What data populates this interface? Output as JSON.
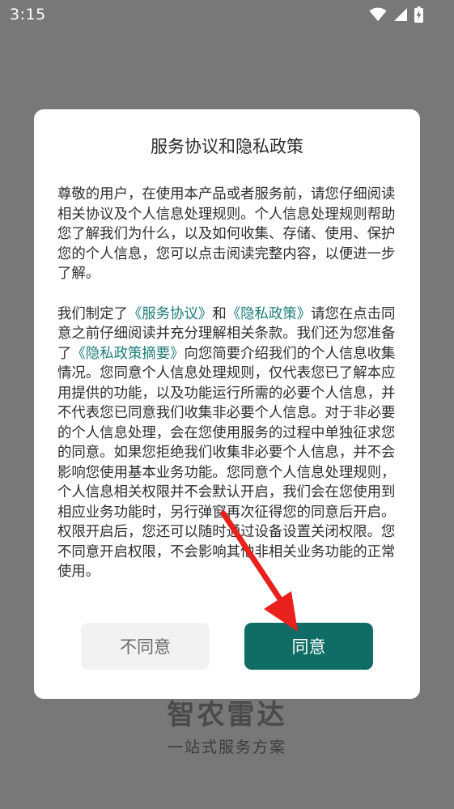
{
  "status_bar": {
    "time": "3:15",
    "icons": [
      "wifi-icon",
      "cellular-signal-icon",
      "battery-charging-icon"
    ],
    "color": "#ffffff"
  },
  "background": {
    "brand_name": "智农雷达",
    "slogan": "一站式服务方案",
    "overlay_color": "#787878"
  },
  "dialog": {
    "title": "服务协议和隐私政策",
    "paragraph1": "尊敬的用户，在使用本产品或者服务前，请您仔细阅读相关协议及个人信息处理规则。个人信息处理规则帮助您了解我们为什么，以及如何收集、存储、使用、保护您的个人信息，您可以点击阅读完整内容，以便进一步了解。",
    "paragraph2": {
      "text_1": "我们制定了",
      "link_service_agreement": "《服务协议》",
      "text_2": "和",
      "link_privacy_policy": "《隐私政策》",
      "text_3": "请您在点击同意之前仔细阅读并充分理解相关条款。我们还为您准备了",
      "link_privacy_summary": "《隐私政策摘要》",
      "text_4": "向您简要介绍我们的个人信息收集情况。您同意个人信息处理规则，仅代表您已了解本应用提供的功能，以及功能运行所需的必要个人信息，并不代表您已同意我们收集非必要个人信息。对于非必要的个人信息处理，会在您使用服务的过程中单独征求您的同意。如果您拒绝我们收集非必要个人信息，并不会影响您使用基本业务功能。您同意个人信息处理规则，个人信息相关权限并不会默认开启，我们会在您使用到相应业务功能时，另行弹窗再次征得您的同意后开启。权限开启后，您还可以随时通过设备设置关闭权限。您不同意开启权限，不会影响其他非相关业务功能的正常使用。"
    },
    "link_color": "#1d7d78",
    "disagree_label": "不同意",
    "agree_label": "同意",
    "agree_color": "#0f6d65"
  },
  "annotation": {
    "icon": "red-arrow-icon",
    "color": "#e8211c"
  }
}
